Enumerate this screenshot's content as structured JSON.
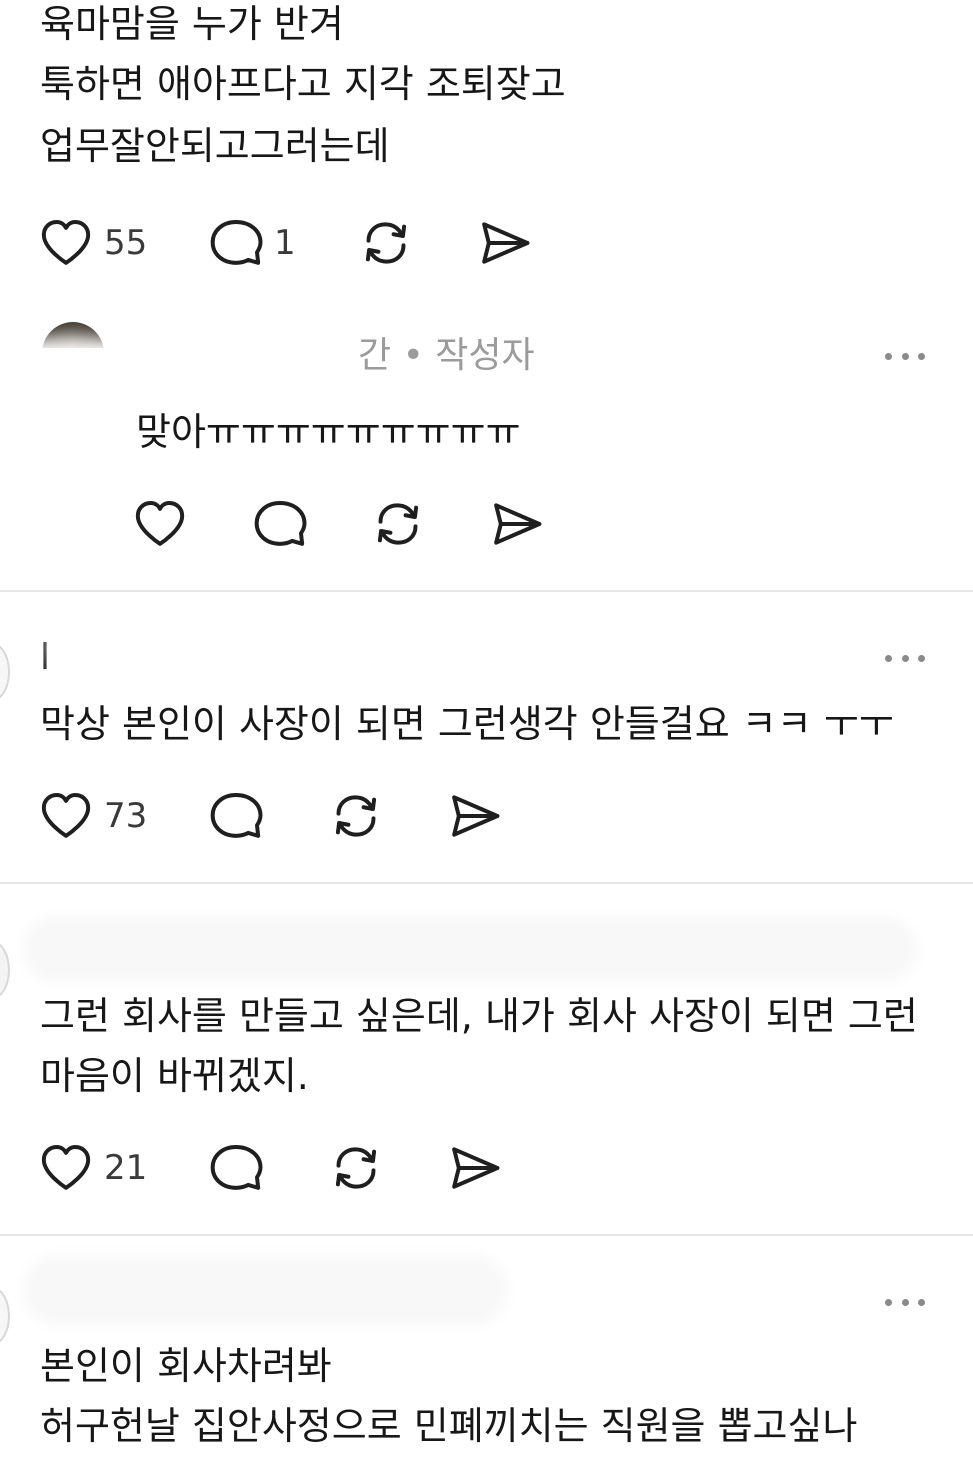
{
  "post1": {
    "lines": [
      "육마맘을 누가 반겨",
      "툭하면 애아프다고 지각 조퇴잦고",
      "업무잘안되고그러는데"
    ],
    "likes": "55",
    "replies": "1"
  },
  "reply1": {
    "meta": "간 • 작성자",
    "text": "맞아ㅠㅠㅠㅠㅠㅠㅠㅠㅠ"
  },
  "post2": {
    "author_partial": "l",
    "text": "막상 본인이 사장이 되면 그런생각 안들걸요 ㅋㅋ ㅜㅜ",
    "likes": "73"
  },
  "post3": {
    "lines": [
      "그런 회사를 만들고 싶은데, 내가 회사 사장이 되면 그런",
      "마음이 바뀌겠지."
    ],
    "likes": "21"
  },
  "post4": {
    "lines": [
      "본인이 회사차려봐",
      "허구헌날 집안사정으로 민폐끼치는 직원을 뽑고싶나"
    ]
  },
  "icons": {
    "like": "heart-icon",
    "reply": "comment-bubble-icon",
    "repost": "repost-arrows-icon",
    "share": "send-paper-plane-icon",
    "more": "more-horizontal-icon"
  },
  "colors": {
    "text": "#171717",
    "muted": "#9b9b9b",
    "divider": "#e6e6e6"
  }
}
